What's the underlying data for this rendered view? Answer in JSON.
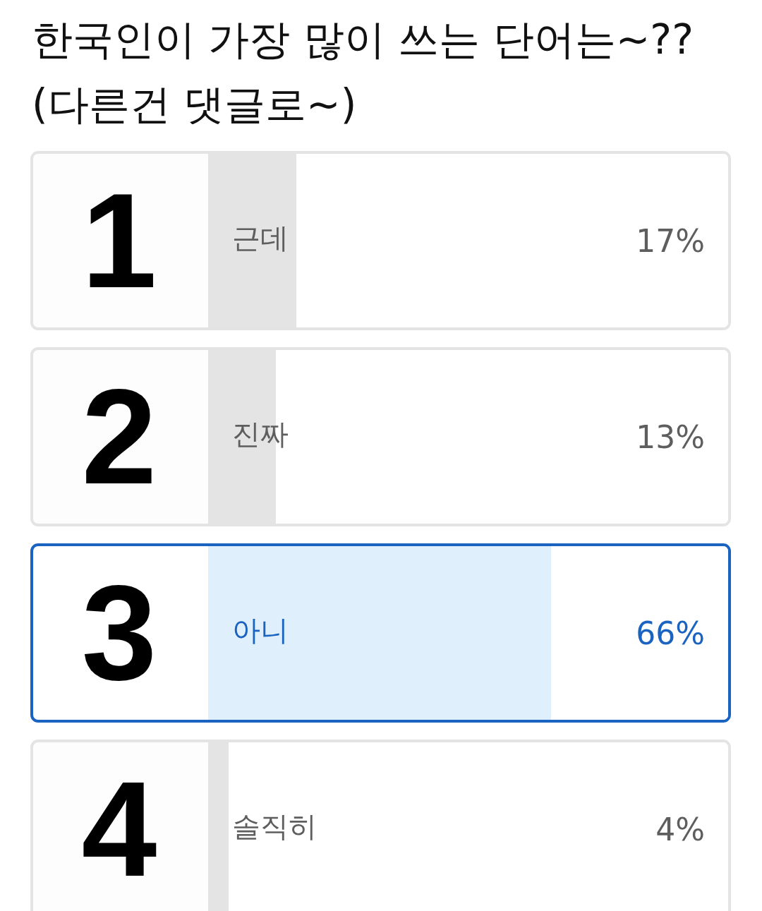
{
  "title_lines": [
    "한국인이 가장 많이 쓰는 단어는~??",
    "(다른건 댓글로~)"
  ],
  "options": [
    {
      "rank": "1",
      "label": "근데",
      "percent": "17%",
      "level": 0.17,
      "selected": false
    },
    {
      "rank": "2",
      "label": "진짜",
      "percent": "13%",
      "level": 0.13,
      "selected": false
    },
    {
      "rank": "3",
      "label": "아니",
      "percent": "66%",
      "level": 0.66,
      "selected": true
    },
    {
      "rank": "4",
      "label": "솔직히",
      "percent": "4%",
      "level": 0.04,
      "selected": false
    }
  ]
}
